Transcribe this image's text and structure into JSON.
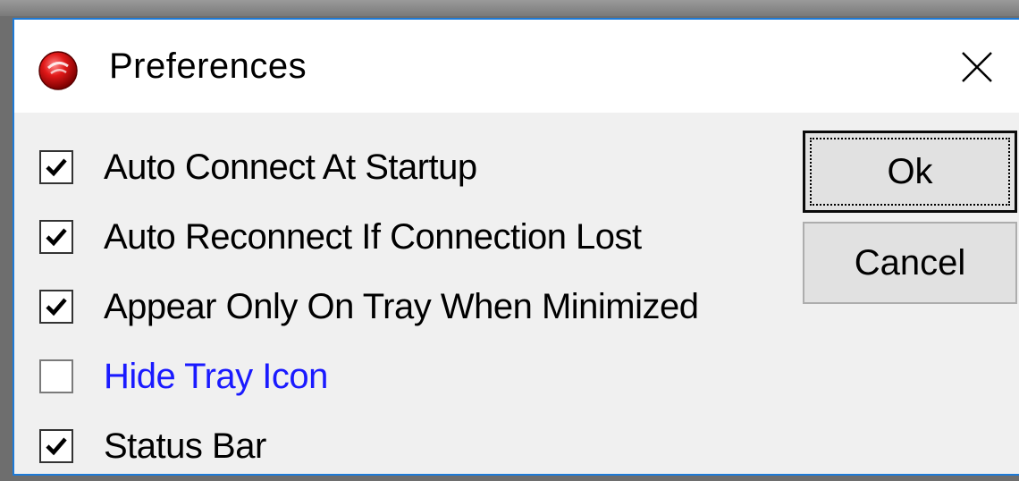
{
  "window": {
    "title": "Preferences",
    "icon": "app-red-orb-icon",
    "close_icon": "close-icon",
    "accent": "#1e7ad6"
  },
  "options": [
    {
      "label": "Auto Connect At Startup",
      "checked": true,
      "color": "#000000"
    },
    {
      "label": "Auto Reconnect If Connection Lost",
      "checked": true,
      "color": "#000000"
    },
    {
      "label": "Appear Only On Tray When Minimized",
      "checked": true,
      "color": "#000000"
    },
    {
      "label": "Hide Tray Icon",
      "checked": false,
      "color": "#1a1aff"
    },
    {
      "label": "Status Bar",
      "checked": true,
      "color": "#000000"
    }
  ],
  "buttons": {
    "ok_label": "Ok",
    "cancel_label": "Cancel"
  }
}
